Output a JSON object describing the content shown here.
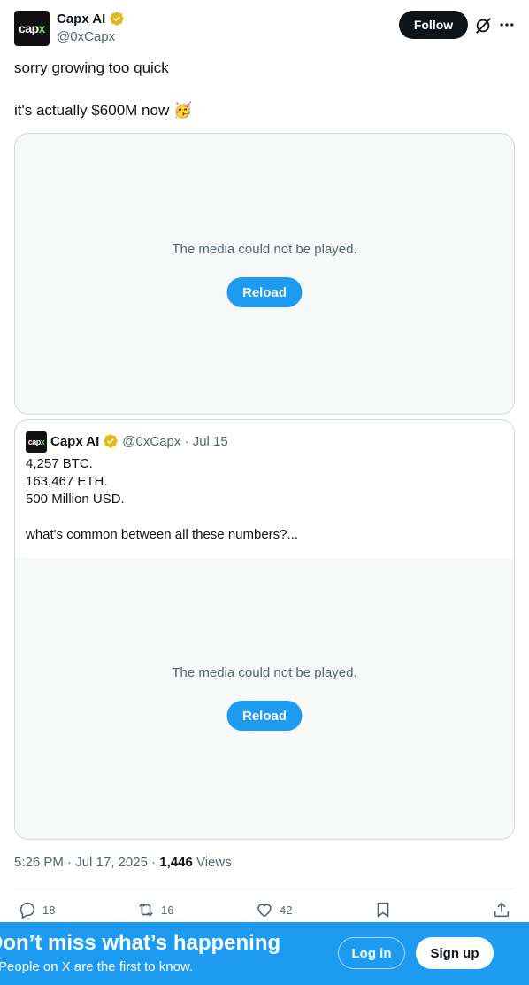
{
  "author": {
    "display_name": "Capx AI",
    "handle": "@0xCapx",
    "logo_text_a": "cap",
    "logo_text_b": "x"
  },
  "header": {
    "follow_label": "Follow"
  },
  "tweet": {
    "line1": "sorry growing too quick",
    "line2": "it's actually $600M now 🥳"
  },
  "media": {
    "error_text": "The media could not be played.",
    "reload_label": "Reload"
  },
  "quote": {
    "display_name": "Capx AI",
    "handle_date": "@0xCapx · Jul 15",
    "lines": [
      "4,257 BTC.",
      "163,467 ETH.",
      "500 Million USD.",
      "what's common between all these numbers?..."
    ],
    "media_error": "The media could not be played.",
    "media_reload": "Reload"
  },
  "meta": {
    "time": "5:26 PM · Jul 17, 2025 · ",
    "views_count": "1,446",
    "views_label": " Views"
  },
  "actions": {
    "replies": "18",
    "reposts": "16",
    "likes": "42"
  },
  "banner": {
    "title": "Don’t miss what’s happening",
    "subtitle": "People on X are the first to know.",
    "login_label": "Log in",
    "signup_label": "Sign up"
  },
  "colors": {
    "accent": "#1d9bf0",
    "text": "#0f1419",
    "muted": "#536471",
    "verified_badge": "#e2b719"
  }
}
